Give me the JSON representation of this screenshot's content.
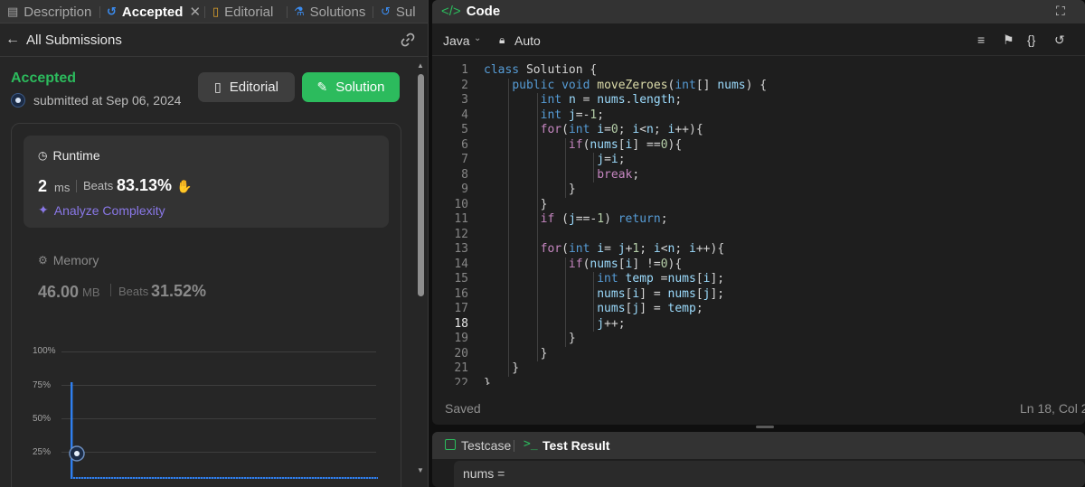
{
  "tabs": [
    {
      "label": "Description",
      "icon": "description-icon"
    },
    {
      "label": "Accepted",
      "icon": "history-icon",
      "active": true,
      "closable": true
    },
    {
      "label": "Editorial",
      "icon": "book-icon"
    },
    {
      "label": "Solutions",
      "icon": "flask-icon"
    },
    {
      "label": "Sul",
      "icon": "history-icon"
    }
  ],
  "subheader": {
    "back_label": "All Submissions",
    "link_icon": "link-icon"
  },
  "submission": {
    "status": "Accepted",
    "submitted": "submitted at Sep 06, 2024",
    "editorial_label": "Editorial",
    "solution_label": "Solution"
  },
  "runtime": {
    "title": "Runtime",
    "value": "2",
    "unit": "ms",
    "beats_label": "Beats",
    "beats_pct": "83.13%",
    "analyze_label": "Analyze Complexity"
  },
  "memory": {
    "title": "Memory",
    "value": "46.00",
    "unit": "MB",
    "beats_label": "Beats",
    "beats_pct": "31.52%"
  },
  "chart_data": {
    "type": "bar",
    "y_ticks": [
      "100%",
      "75%",
      "50%",
      "25%"
    ],
    "ylim": [
      0,
      100
    ],
    "values": [
      77,
      2,
      2,
      2,
      2,
      2,
      2,
      2,
      2,
      2,
      2,
      2,
      2,
      2,
      2,
      2,
      2,
      2,
      2,
      2,
      2,
      2,
      2,
      2,
      2,
      2,
      2,
      2,
      2,
      2,
      2,
      2,
      2,
      2,
      2,
      2,
      2,
      2,
      2,
      2,
      2,
      2,
      2,
      2,
      2,
      2,
      2,
      2,
      2,
      2,
      2,
      2,
      2,
      2,
      2,
      2,
      2,
      2,
      2,
      2,
      2,
      2,
      2,
      2,
      2,
      2,
      2,
      2,
      2,
      2,
      2,
      2,
      2,
      2,
      2,
      2,
      2,
      2,
      2,
      2,
      2,
      2,
      2,
      2,
      2,
      2,
      2,
      2,
      2,
      2,
      2,
      2,
      2,
      2,
      2,
      2,
      2,
      2,
      2,
      2,
      2,
      2,
      2,
      2,
      2,
      2,
      2,
      2,
      2,
      2,
      2,
      2,
      2,
      2,
      2,
      2
    ],
    "marker_value": 25,
    "bar_color": "#2f7ff0"
  },
  "editor": {
    "title": "Code",
    "language": "Java",
    "mode": "Auto",
    "status": "Saved",
    "cursor": "Ln 18, Col 2",
    "current_line": 18
  },
  "code_lines": [
    "class Solution {",
    "    public void moveZeroes(int[] nums) {",
    "        int n = nums.length;",
    "        int j=-1;",
    "        for(int i=0; i<n; i++){",
    "            if(nums[i] ==0){",
    "                j=i;",
    "                break;",
    "            }",
    "        }",
    "        if (j==-1) return;",
    "",
    "        for(int i= j+1; i<n; i++){",
    "            if(nums[i] !=0){",
    "                int temp =nums[i];",
    "                nums[i] = nums[j];",
    "                nums[j] = temp;",
    "                j++;",
    "            }",
    "        }",
    "    }",
    "}"
  ],
  "bottom": {
    "testcase_label": "Testcase",
    "result_label": "Test Result",
    "nums_label": "nums ="
  },
  "colors": {
    "accent": "#2cbb5d",
    "analyze": "#8a78e8",
    "bar": "#2f7ff0"
  }
}
